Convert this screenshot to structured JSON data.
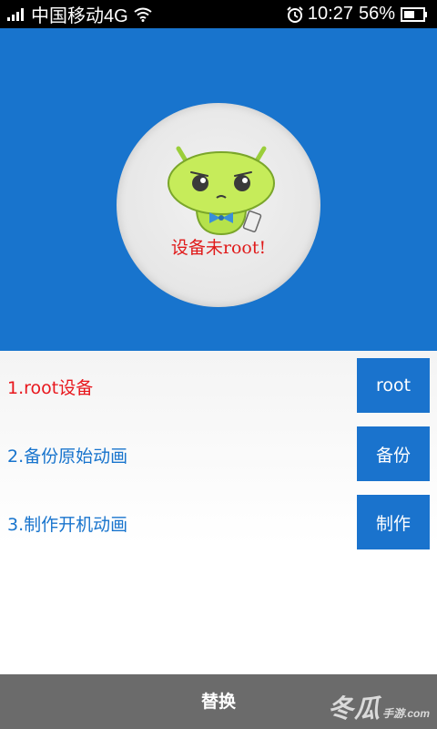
{
  "status_bar": {
    "carrier": "中国移动4G",
    "time": "10:27",
    "battery": "56%",
    "icons": [
      "signal-icon",
      "wifi-icon",
      "alarm-icon",
      "battery-icon"
    ]
  },
  "header": {
    "background_color": "#1874cd",
    "avatar_status": "设备未root!",
    "mascot": "android-mascot-icon"
  },
  "steps": [
    {
      "label": "1.root设备",
      "button": "root"
    },
    {
      "label": "2.备份原始动画",
      "button": "备份"
    },
    {
      "label": "3.制作开机动画",
      "button": "制作"
    }
  ],
  "bottom_bar": {
    "action_label": "替换",
    "watermark": "冬瓜",
    "watermark_sub": "手游.com"
  },
  "colors": {
    "accent": "#1874cd",
    "active_step": "#e8161c",
    "bottom_bar": "#6b6b6b"
  }
}
